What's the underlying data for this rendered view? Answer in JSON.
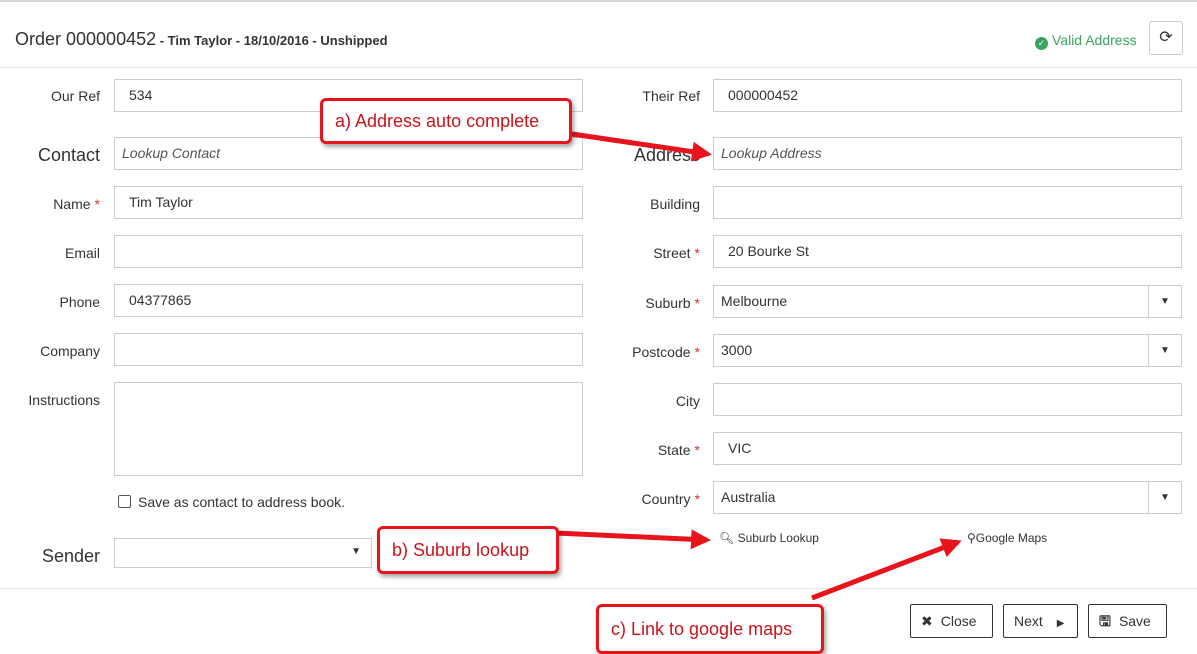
{
  "header": {
    "order_label": "Order 000000452",
    "order_sub": " - Tim Taylor - 18/10/2016 - Unshipped",
    "valid_text": "Valid Address",
    "refresh_icon": "refresh-icon"
  },
  "left": {
    "our_ref_label": "Our Ref",
    "our_ref_value": "534",
    "contact_label": "Contact",
    "contact_placeholder": "Lookup Contact",
    "name_label": "Name",
    "name_value": "Tim Taylor",
    "email_label": "Email",
    "email_value": "",
    "phone_label": "Phone",
    "phone_value": "04377865",
    "company_label": "Company",
    "company_value": "",
    "instructions_label": "Instructions",
    "save_contact_label": "Save as contact to address book.",
    "sender_label": "Sender",
    "sender_value": ""
  },
  "right": {
    "their_ref_label": "Their Ref",
    "their_ref_value": "000000452",
    "address_label": "Address",
    "address_placeholder": "Lookup Address",
    "building_label": "Building",
    "building_value": "",
    "street_label": "Street",
    "street_value": "20 Bourke St",
    "suburb_label": "Suburb",
    "suburb_value": "Melbourne",
    "postcode_label": "Postcode",
    "postcode_value": "3000",
    "city_label": "City",
    "city_value": "",
    "state_label": "State",
    "state_value": "VIC",
    "country_label": "Country",
    "country_value": "Australia",
    "suburb_lookup_link": "Suburb Lookup",
    "google_maps_link": "Google Maps"
  },
  "footer": {
    "close_label": "Close",
    "next_label": "Next",
    "save_label": "Save"
  },
  "annotations": {
    "a": "a) Address auto complete",
    "b": "b) Suburb lookup",
    "c": "c) Link to google maps",
    "color": "#e8141c"
  },
  "colors": {
    "valid_green": "#3aa35f",
    "required_red": "#cc3333"
  }
}
